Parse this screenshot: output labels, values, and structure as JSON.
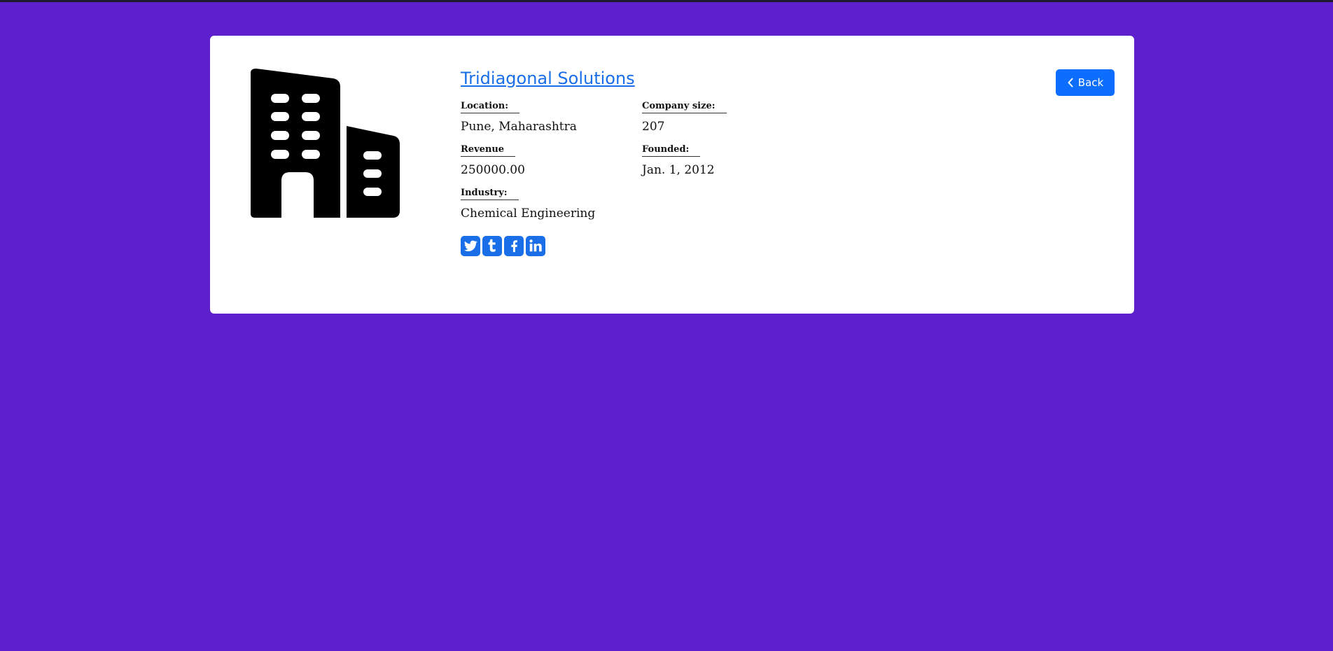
{
  "company": {
    "name": "Tridiagonal Solutions",
    "logo_icon": "building-icon"
  },
  "fields": {
    "location_label": "Location:",
    "location_value": "Pune, Maharashtra",
    "size_label": "Company size:",
    "size_value": "207",
    "revenue_label": "Revenue",
    "revenue_value": "250000.00",
    "founded_label": "Founded:",
    "founded_value": "Jan. 1, 2012",
    "industry_label": "Industry:",
    "industry_value": "Chemical Engineering"
  },
  "social": {
    "icons": [
      "twitter-icon",
      "tumblr-icon",
      "facebook-icon",
      "linkedin-icon"
    ]
  },
  "back_button": {
    "label": "Back",
    "icon": "chevron-left-icon"
  },
  "colors": {
    "background": "#5e20cc",
    "card": "#ffffff",
    "link": "#1a6fe8",
    "button": "#0d6efd"
  }
}
